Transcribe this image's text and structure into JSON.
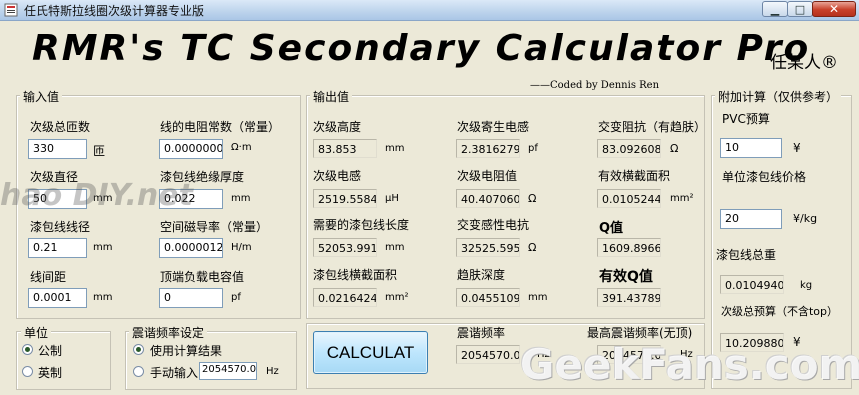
{
  "window": {
    "title": "任氏特斯拉线圈次级计算器专业版",
    "min_glyph": "▁",
    "max_glyph": "□",
    "close_glyph": "✕"
  },
  "header": {
    "title": "RMR's TC Secondary Calculator Pro",
    "author_badge": "任某人®",
    "coded_by": "——Coded by Dennis Ren"
  },
  "inputs": {
    "group_title": "输入值",
    "turns": {
      "label": "次级总匝数",
      "value": "330",
      "unit": "匝"
    },
    "coil_diameter": {
      "label": "次级直径",
      "value": "50",
      "unit": "mm"
    },
    "wire_diameter": {
      "label": "漆包线线径",
      "value": "0.21",
      "unit": "mm"
    },
    "spacing": {
      "label": "线间距",
      "value": "0.0001",
      "unit": "mm"
    },
    "resistivity": {
      "label": "线的电阻常数（常量）",
      "value": "0.0000000",
      "unit": "Ω·m"
    },
    "insulation": {
      "label": "漆包线绝缘厚度",
      "value": "0.022",
      "unit": "mm"
    },
    "permeability": {
      "label": "空间磁导率（常量）",
      "value": "0.0000012",
      "unit": "H/m"
    },
    "top_load_cap": {
      "label": "顶端负载电容值",
      "value": "0",
      "unit": "pf"
    }
  },
  "outputs": {
    "group_title": "输出值",
    "height": {
      "label": "次级高度",
      "value": "83.853",
      "unit": "mm"
    },
    "inductance": {
      "label": "次级电感",
      "value": "2519.5584",
      "unit": "μH"
    },
    "wire_length": {
      "label": "需要的漆包线长度",
      "value": "52053.991",
      "unit": "mm"
    },
    "wire_area": {
      "label": "漆包线横截面积",
      "value": "0.0216424",
      "unit": "mm²"
    },
    "parasitic_cap": {
      "label": "次级寄生电感",
      "value": "2.3816279",
      "unit": "pf"
    },
    "resistance": {
      "label": "次级电阻值",
      "value": "40.407060",
      "unit": "Ω"
    },
    "reactance": {
      "label": "交变感性电抗",
      "value": "32525.595",
      "unit": "Ω"
    },
    "skin_depth": {
      "label": "趋肤深度",
      "value": "0.0455109",
      "unit": "mm"
    },
    "ac_resistance": {
      "label": "交变阻抗（有趋肤）",
      "value": "83.092608",
      "unit": "Ω"
    },
    "effective_area": {
      "label": "有效横截面积",
      "value": "0.0105244",
      "unit": "mm²"
    },
    "q": {
      "label": "Q值",
      "value": "1609.8966"
    },
    "effective_q": {
      "label": "有效Q值",
      "value": "391.43789"
    }
  },
  "extra": {
    "group_title": "附加计算（仅供参考）",
    "pvc_budget": {
      "label": "PVC预算",
      "value": "10",
      "unit": "¥"
    },
    "wire_price": {
      "label": "单位漆包线价格",
      "value": "20",
      "unit": "¥/kg"
    },
    "wire_weight": {
      "label": "漆包线总重",
      "value": "0.0104940",
      "unit": "kg"
    },
    "total_budget": {
      "label": "次级总预算（不含top）",
      "value": "10.209880",
      "unit": "¥"
    }
  },
  "units_group": {
    "title": "单位",
    "metric": "公制",
    "imperial": "英制",
    "selected": "metric"
  },
  "resonance_group": {
    "title": "震谐频率设定",
    "use_calc": "使用计算结果",
    "manual": "手动输入",
    "manual_value": "2054570.0",
    "manual_unit": "Hz",
    "selected": "use_calc"
  },
  "calc_button": "CALCULAT",
  "resonance": {
    "label": "震谐频率",
    "value": "2054570.0",
    "unit": "Hz",
    "max_label": "最高震谐频率(无顶)",
    "max_value": "2054570.0",
    "max_unit": "Hz"
  },
  "watermarks": {
    "left": "hao DIY.net",
    "right": "GeekFans.com"
  }
}
